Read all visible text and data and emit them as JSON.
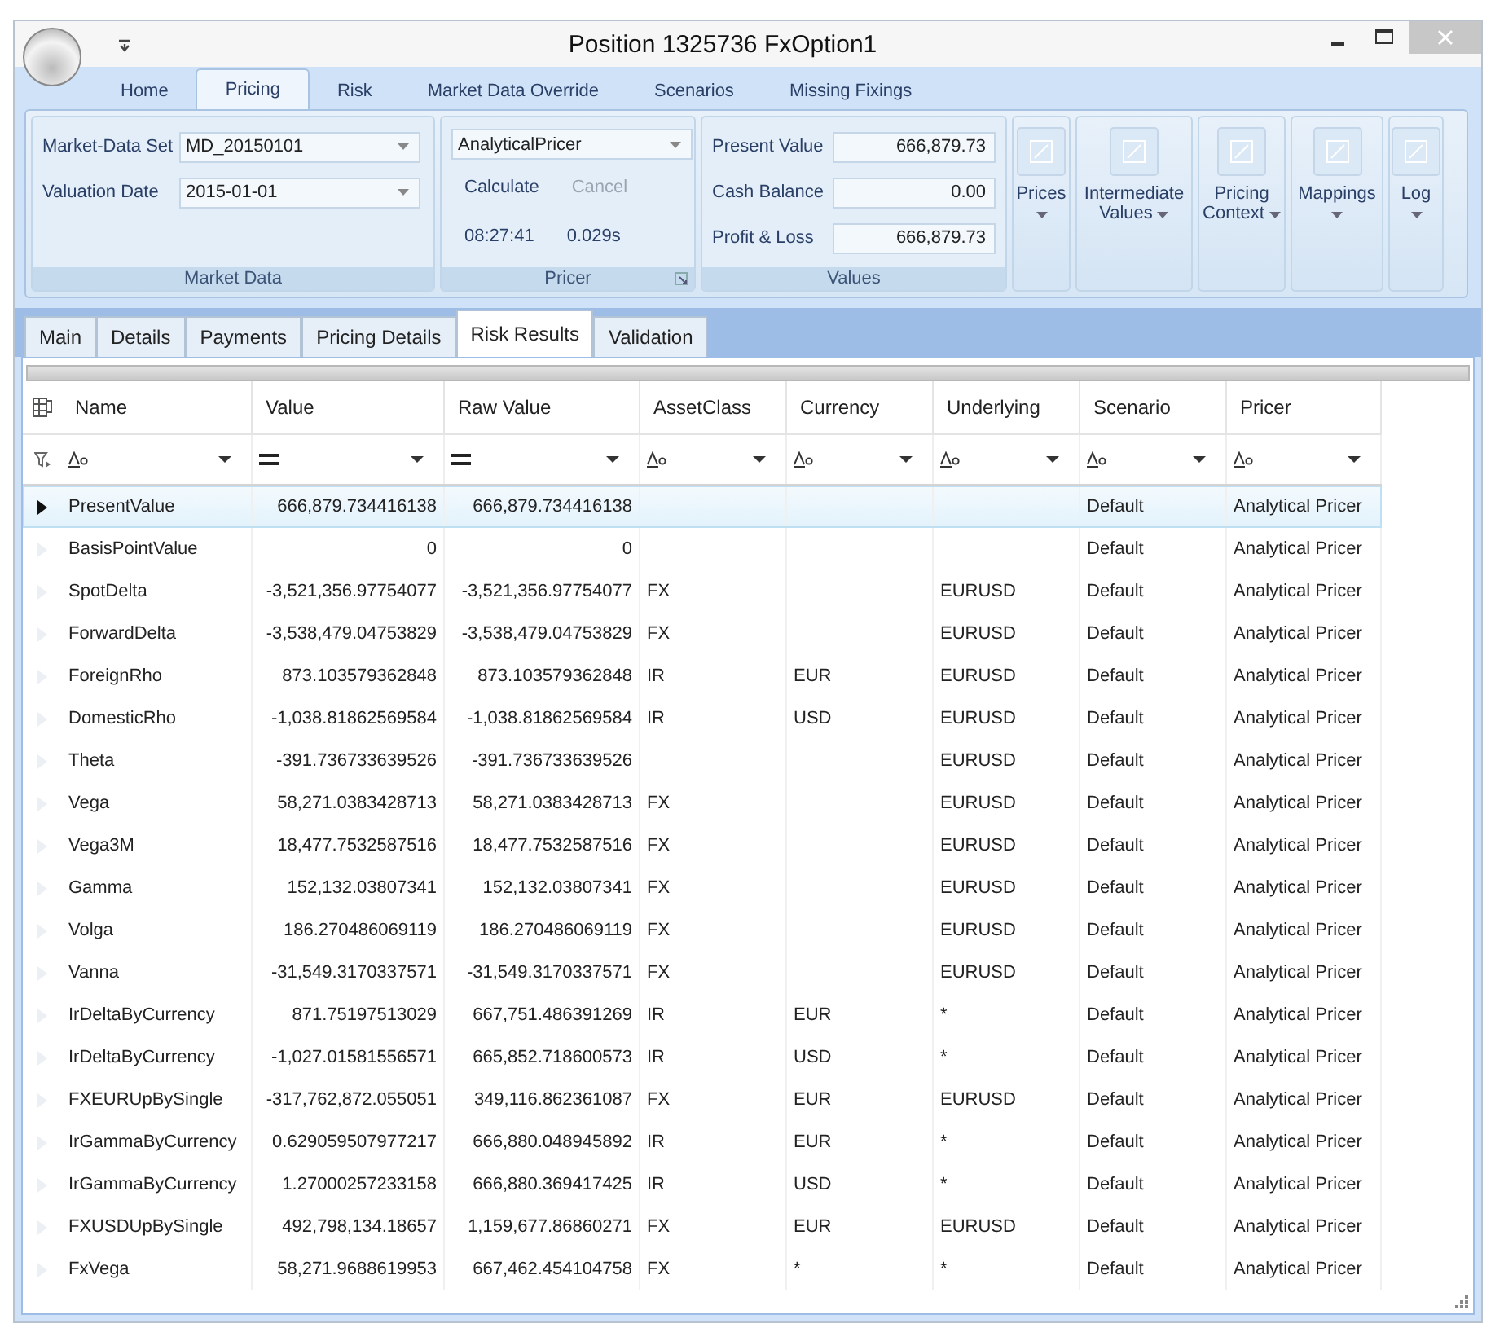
{
  "window": {
    "title": "Position 1325736 FxOption1"
  },
  "ribbon_tabs": [
    {
      "label": "Home",
      "selected": false
    },
    {
      "label": "Pricing",
      "selected": true
    },
    {
      "label": "Risk",
      "selected": false
    },
    {
      "label": "Market Data Override",
      "selected": false
    },
    {
      "label": "Scenarios",
      "selected": false
    },
    {
      "label": "Missing Fixings",
      "selected": false
    }
  ],
  "market_data": {
    "title": "Market Data",
    "fields": [
      {
        "label": "Market-Data Set",
        "value": "MD_20150101"
      },
      {
        "label": "Valuation Date",
        "value": "2015-01-01"
      }
    ]
  },
  "pricer": {
    "title": "Pricer",
    "selection": "AnalyticalPricer",
    "buttons": [
      {
        "label": "Calculate",
        "disabled": false
      },
      {
        "label": "Cancel",
        "disabled": true
      }
    ],
    "time": "08:27:41",
    "duration": "0.029s"
  },
  "values": {
    "title": "Values",
    "fields": [
      {
        "label": "Present Value",
        "value": "666,879.73"
      },
      {
        "label": "Cash Balance",
        "value": "0.00"
      },
      {
        "label": "Profit & Loss",
        "value": "666,879.73"
      }
    ]
  },
  "large_buttons": [
    {
      "label": "Prices"
    },
    {
      "label": "Intermediate Values"
    },
    {
      "label": "Pricing Context"
    },
    {
      "label": "Mappings"
    },
    {
      "label": "Log"
    }
  ],
  "doc_tabs": [
    {
      "label": "Main",
      "selected": false
    },
    {
      "label": "Details",
      "selected": false
    },
    {
      "label": "Payments",
      "selected": false
    },
    {
      "label": "Pricing Details",
      "selected": false
    },
    {
      "label": "Risk Results",
      "selected": true
    },
    {
      "label": "Validation",
      "selected": false
    }
  ],
  "grid": {
    "columns": [
      {
        "label": "Name",
        "kind": "text"
      },
      {
        "label": "Value",
        "kind": "numeric"
      },
      {
        "label": "Raw Value",
        "kind": "numeric"
      },
      {
        "label": "AssetClass",
        "kind": "text"
      },
      {
        "label": "Currency",
        "kind": "text"
      },
      {
        "label": "Underlying",
        "kind": "text"
      },
      {
        "label": "Scenario",
        "kind": "text"
      },
      {
        "label": "Pricer",
        "kind": "text"
      }
    ],
    "rows": [
      {
        "selected": true,
        "cells": [
          "PresentValue",
          "666,879.734416138",
          "666,879.734416138",
          "",
          "",
          "",
          "Default",
          "Analytical Pricer"
        ]
      },
      {
        "selected": false,
        "cells": [
          "BasisPointValue",
          "0",
          "0",
          "",
          "",
          "",
          "Default",
          "Analytical Pricer"
        ]
      },
      {
        "selected": false,
        "cells": [
          "SpotDelta",
          "-3,521,356.97754077",
          "-3,521,356.97754077",
          "FX",
          "",
          "EURUSD",
          "Default",
          "Analytical Pricer"
        ]
      },
      {
        "selected": false,
        "cells": [
          "ForwardDelta",
          "-3,538,479.04753829",
          "-3,538,479.04753829",
          "FX",
          "",
          "EURUSD",
          "Default",
          "Analytical Pricer"
        ]
      },
      {
        "selected": false,
        "cells": [
          "ForeignRho",
          "873.103579362848",
          "873.103579362848",
          "IR",
          "EUR",
          "EURUSD",
          "Default",
          "Analytical Pricer"
        ]
      },
      {
        "selected": false,
        "cells": [
          "DomesticRho",
          "-1,038.81862569584",
          "-1,038.81862569584",
          "IR",
          "USD",
          "EURUSD",
          "Default",
          "Analytical Pricer"
        ]
      },
      {
        "selected": false,
        "cells": [
          "Theta",
          "-391.736733639526",
          "-391.736733639526",
          "",
          "",
          "EURUSD",
          "Default",
          "Analytical Pricer"
        ]
      },
      {
        "selected": false,
        "cells": [
          "Vega",
          "58,271.0383428713",
          "58,271.0383428713",
          "FX",
          "",
          "EURUSD",
          "Default",
          "Analytical Pricer"
        ]
      },
      {
        "selected": false,
        "cells": [
          "Vega3M",
          "18,477.7532587516",
          "18,477.7532587516",
          "FX",
          "",
          "EURUSD",
          "Default",
          "Analytical Pricer"
        ]
      },
      {
        "selected": false,
        "cells": [
          "Gamma",
          "152,132.03807341",
          "152,132.03807341",
          "FX",
          "",
          "EURUSD",
          "Default",
          "Analytical Pricer"
        ]
      },
      {
        "selected": false,
        "cells": [
          "Volga",
          "186.270486069119",
          "186.270486069119",
          "FX",
          "",
          "EURUSD",
          "Default",
          "Analytical Pricer"
        ]
      },
      {
        "selected": false,
        "cells": [
          "Vanna",
          "-31,549.3170337571",
          "-31,549.3170337571",
          "FX",
          "",
          "EURUSD",
          "Default",
          "Analytical Pricer"
        ]
      },
      {
        "selected": false,
        "cells": [
          "IrDeltaByCurrency",
          "871.75197513029",
          "667,751.486391269",
          "IR",
          "EUR",
          "*",
          "Default",
          "Analytical Pricer"
        ]
      },
      {
        "selected": false,
        "cells": [
          "IrDeltaByCurrency",
          "-1,027.01581556571",
          "665,852.718600573",
          "IR",
          "USD",
          "*",
          "Default",
          "Analytical Pricer"
        ]
      },
      {
        "selected": false,
        "cells": [
          "FXEURUpBySingle",
          "-317,762,872.055051",
          "349,116.862361087",
          "FX",
          "EUR",
          "EURUSD",
          "Default",
          "Analytical Pricer"
        ]
      },
      {
        "selected": false,
        "cells": [
          "IrGammaByCurrency",
          "0.629059507977217",
          "666,880.048945892",
          "IR",
          "EUR",
          "*",
          "Default",
          "Analytical Pricer"
        ]
      },
      {
        "selected": false,
        "cells": [
          "IrGammaByCurrency",
          "1.27000257233158",
          "666,880.369417425",
          "IR",
          "USD",
          "*",
          "Default",
          "Analytical Pricer"
        ]
      },
      {
        "selected": false,
        "cells": [
          "FXUSDUpBySingle",
          "492,798,134.18657",
          "1,159,677.86860271",
          "FX",
          "EUR",
          "EURUSD",
          "Default",
          "Analytical Pricer"
        ]
      },
      {
        "selected": false,
        "cells": [
          "FxVega",
          "58,271.9688619953",
          "667,462.454104758",
          "FX",
          "*",
          "*",
          "Default",
          "Analytical Pricer"
        ]
      }
    ]
  }
}
